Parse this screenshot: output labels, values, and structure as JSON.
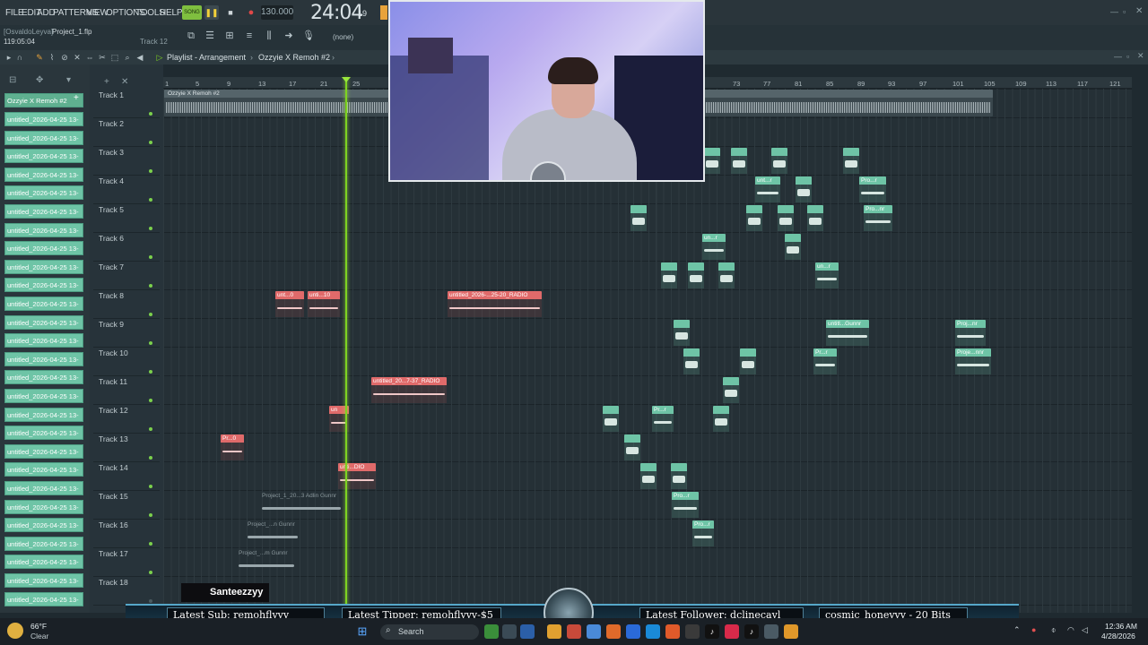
{
  "menu": [
    "FILE",
    "EDIT",
    "ADD",
    "PATTERNS",
    "VIEW",
    "OPTIONS",
    "TOOLS",
    "HELP"
  ],
  "transport": {
    "song_label": "SONG",
    "tempo": "130.000",
    "clock": "24:04",
    "clock_small": "19"
  },
  "project": {
    "user": "[OsvaldoLeyva]",
    "file": "Project_1.flp",
    "time": "119:05:04",
    "hint": "Track 12",
    "pattern_select": "(none)"
  },
  "playlist": {
    "title": "Playlist - Arrangement",
    "separator": "›",
    "pattern": "Ozzyie X Remoh #2",
    "pattern_arrow": "›"
  },
  "picker": {
    "selected": "Ozzyie X Remoh #2",
    "items": [
      "untitled_2026-04-25 13-",
      "untitled_2026-04-25 13-",
      "untitled_2026-04-25 13-",
      "untitled_2026-04-25 13-",
      "untitled_2026-04-25 13-",
      "untitled_2026-04-25 13-",
      "untitled_2026-04-25 13-",
      "untitled_2026-04-25 13-",
      "untitled_2026-04-25 13-",
      "untitled_2026-04-25 13-",
      "untitled_2026-04-25 13-",
      "untitled_2026-04-25 13-",
      "untitled_2026-04-25 13-",
      "untitled_2026-04-25 13-",
      "untitled_2026-04-25 13-",
      "untitled_2026-04-25 13-",
      "untitled_2026-04-25 13-",
      "untitled_2026-04-25 13-",
      "untitled_2026-04-25 13-",
      "untitled_2026-04-25 13-",
      "untitled_2026-04-25 13-",
      "untitled_2026-04-25 13-",
      "untitled_2026-04-25 13-",
      "untitled_2026-04-25 13-",
      "untitled_2026-04-25 13-",
      "untitled_2026-04-25 13-",
      "untitled_2026-04-25 13-",
      "untitled_2026-04-25 13-"
    ]
  },
  "tracks": [
    "Track 1",
    "Track 2",
    "Track 3",
    "Track 4",
    "Track 5",
    "Track 6",
    "Track 7",
    "Track 8",
    "Track 9",
    "Track 10",
    "Track 11",
    "Track 12",
    "Track 13",
    "Track 14",
    "Track 15",
    "Track 16",
    "Track 17",
    "Track 18"
  ],
  "ruler": [
    "1",
    "5",
    "9",
    "13",
    "17",
    "21",
    "25",
    "73",
    "77",
    "81",
    "85",
    "89",
    "93",
    "97",
    "101",
    "105",
    "109",
    "113",
    "117",
    "121"
  ],
  "clips": {
    "track1": "Ozzyie X Remoh #2",
    "c1": "unt...0",
    "c2": "unti...10",
    "c3": "untitled_2026-...25-20_RADIO",
    "c4": "untitled_20...7-37_RADIO",
    "c5": "un",
    "c6": "Pr...0",
    "c7": "unti...DIO",
    "c8": "Project_1_20...3 Adlin Gunnr",
    "c9": "Project_...n Gunnr",
    "c10": "Project_...m Gunnr",
    "t1": "unt...r",
    "t2": "Pro...r",
    "t3": "Pro...nr",
    "t4": "un...r",
    "t5": "un...r",
    "t6": "untitl...Gunnr",
    "t7": "Pr...r",
    "t8": "Proj...nr",
    "t9": "Proje...nnr",
    "t10": "Pro...r",
    "t11": "Pr...r",
    "t12": "Pro...r"
  },
  "stream": {
    "twitch_user": "Santeezzyy",
    "latest_sub": "Latest Sub: remohflyyy",
    "latest_tipper": "Latest Tipper: remohflyyy-$5",
    "latest_follower": "Latest Follower: dclinecayl",
    "latest_bits": "cosmic_honeyyy - 20 Bits"
  },
  "taskbar": {
    "temp": "66°F",
    "weather": "Clear",
    "search": "Search",
    "time": "12:36 AM",
    "date": "4/28/2026"
  }
}
